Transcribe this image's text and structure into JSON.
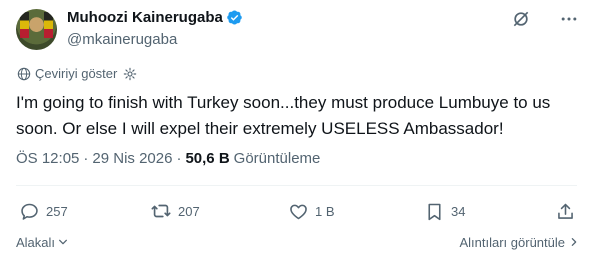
{
  "author": {
    "display_name": "Muhoozi Kainerugaba",
    "handle": "@mkainerugaba",
    "verified": true
  },
  "translate": {
    "label": "Çeviriyi göster"
  },
  "tweet": {
    "text": "I'm going to finish with Turkey soon...they must produce Lumbuye to us soon. Or else I will expel their extremely USELESS Ambassador!"
  },
  "meta": {
    "time": "ÖS 12:05",
    "separator": "·",
    "date": "29 Nis 2026",
    "views": "50,6 B",
    "views_label": "Görüntüleme"
  },
  "actions": {
    "replies": "257",
    "reposts": "207",
    "likes": "1 B",
    "bookmarks": "34"
  },
  "footer": {
    "related": "Alakalı",
    "quotes": "Alıntıları görüntüle"
  },
  "colors": {
    "text": "#0f1419",
    "secondary": "#536471",
    "verified": "#1d9bf0",
    "divider": "#eff3f4"
  }
}
